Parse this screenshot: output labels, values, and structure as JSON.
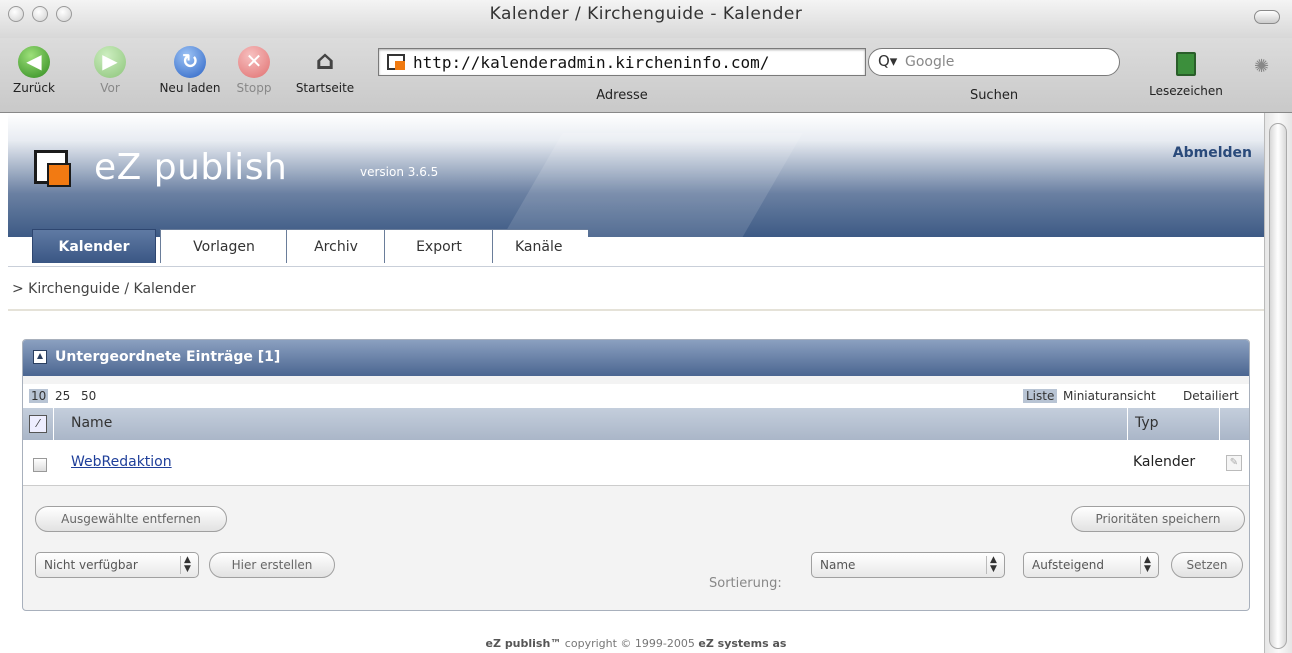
{
  "window": {
    "title": "Kalender / Kirchenguide - Kalender"
  },
  "toolbar": {
    "back": "Zurück",
    "forward": "Vor",
    "reload": "Neu laden",
    "stop": "Stopp",
    "home": "Startseite",
    "address_label": "Adresse",
    "url": "http://kalenderadmin.kirchen​info.com/",
    "search_placeholder": "Google",
    "search_label": "Suchen",
    "bookmarks_label": "Lesezeichen"
  },
  "header": {
    "logo_text": "eZ publish",
    "version": "version 3.6.5",
    "logout": "Abmelden"
  },
  "tabs": [
    {
      "label": "Kalender",
      "active": true
    },
    {
      "label": "Vorlagen"
    },
    {
      "label": "Archiv"
    },
    {
      "label": "Export"
    },
    {
      "label": "Kanäle"
    }
  ],
  "breadcrumb": "> Kirchenguide / Kalender",
  "panel": {
    "title": "Untergeordnete Einträge [1]",
    "pager": [
      "10",
      "25",
      "50"
    ],
    "views": [
      "Liste",
      "Miniaturansicht",
      "Detailiert"
    ],
    "columns": {
      "toggle": "⁄",
      "name": "Name",
      "type": "Typ"
    },
    "rows": [
      {
        "name": "WebRedaktion",
        "type": "Kalender"
      }
    ],
    "remove_button": "Ausgewählte entfernen",
    "priority_button": "Prioritäten speichern",
    "class_select": "Nicht verfügbar",
    "create_button": "Hier erstellen",
    "sort_label": "Sortierung:",
    "sort_field": "Name",
    "sort_order": "Aufsteigend",
    "set_button": "Setzen"
  },
  "footer": {
    "brand": "eZ publish™",
    "text": " copyright © 1999-2005 ",
    "company": "eZ systems as"
  }
}
